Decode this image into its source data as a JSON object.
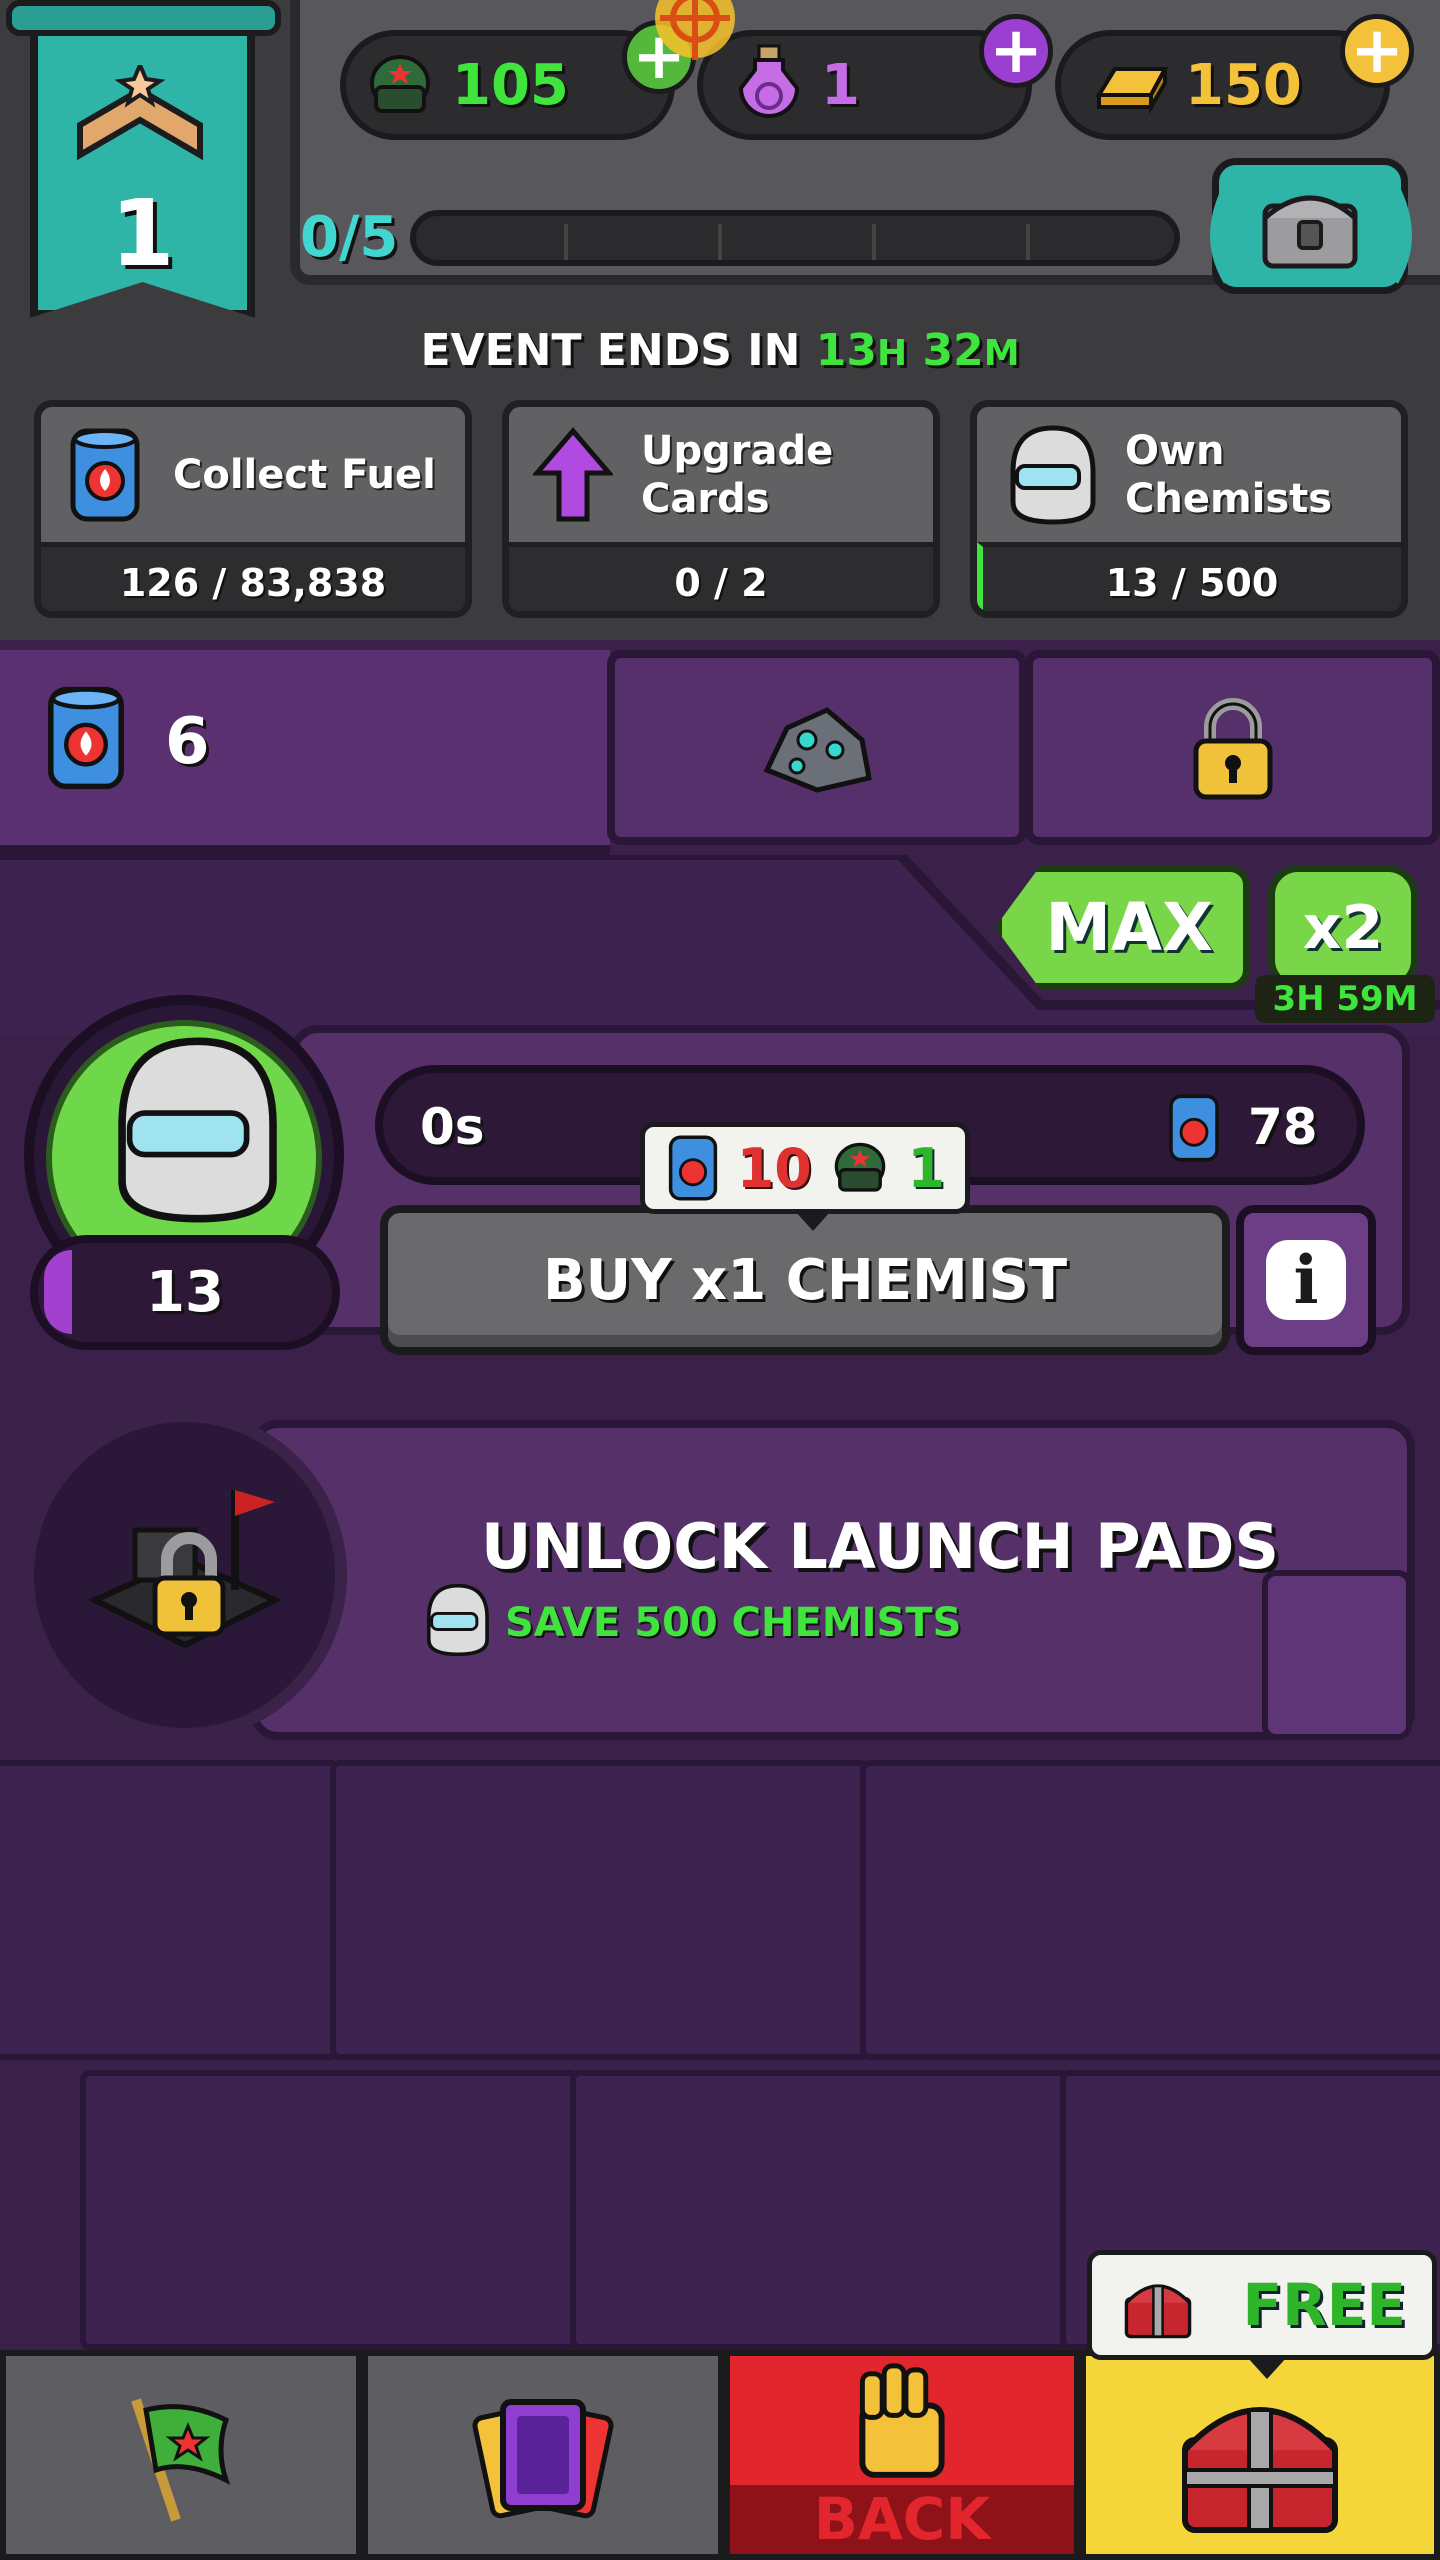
{
  "header": {
    "rank_number": "1",
    "helmets_value": "105",
    "potions_value": "1",
    "gold_value": "150",
    "progress_label": "0/5"
  },
  "event": {
    "prefix": "EVENT ENDS IN",
    "hours": "13",
    "hours_unit": "H",
    "minutes": "32",
    "minutes_unit": "M"
  },
  "tasks": [
    {
      "title_line1": "Collect Fuel",
      "title_line2": "",
      "progress": "126 / 83,838"
    },
    {
      "title_line1": "Upgrade",
      "title_line2": "Cards",
      "progress": "0 / 2"
    },
    {
      "title_line1": "Own",
      "title_line2": "Chemists",
      "progress": "13 / 500"
    }
  ],
  "fuel": {
    "count": "6"
  },
  "multiplier": {
    "max_label": "MAX",
    "x2_label": "x2",
    "timer": "3H 59M"
  },
  "chemist": {
    "level": "13",
    "level_fill_fraction": 0.1,
    "timer_left": "0s",
    "timer_right": "78",
    "cost_fuel": "10",
    "cost_helmet": "1",
    "buy_label": "BUY x1 CHEMIST",
    "info_label": "i"
  },
  "launch": {
    "title": "UNLOCK LAUNCH PADS",
    "subtitle": "SAVE 500 CHEMISTS"
  },
  "nav": {
    "back_label": "BACK",
    "free_label": "FREE"
  },
  "icons": {
    "rank": "chevron-rank-icon",
    "helmet": "soldier-helmet-icon",
    "potion": "potion-icon",
    "gold": "gold-bar-icon",
    "chest": "locked-chest-icon",
    "fuel": "fuel-can-icon",
    "upgrade": "purple-arrow-icon",
    "chemist": "chemist-helmet-icon",
    "ore": "ore-rock-icon",
    "lock": "padlock-icon",
    "flag": "flag-icon",
    "cards": "cards-icon",
    "fist": "fist-icon",
    "launch_pad": "launch-pad-icon"
  },
  "colors": {
    "accent_green": "#3fe43d",
    "teal": "#2fb5a8",
    "purple": "#553069",
    "back_red": "#e3262d",
    "chest_yellow": "#f4d63a"
  }
}
